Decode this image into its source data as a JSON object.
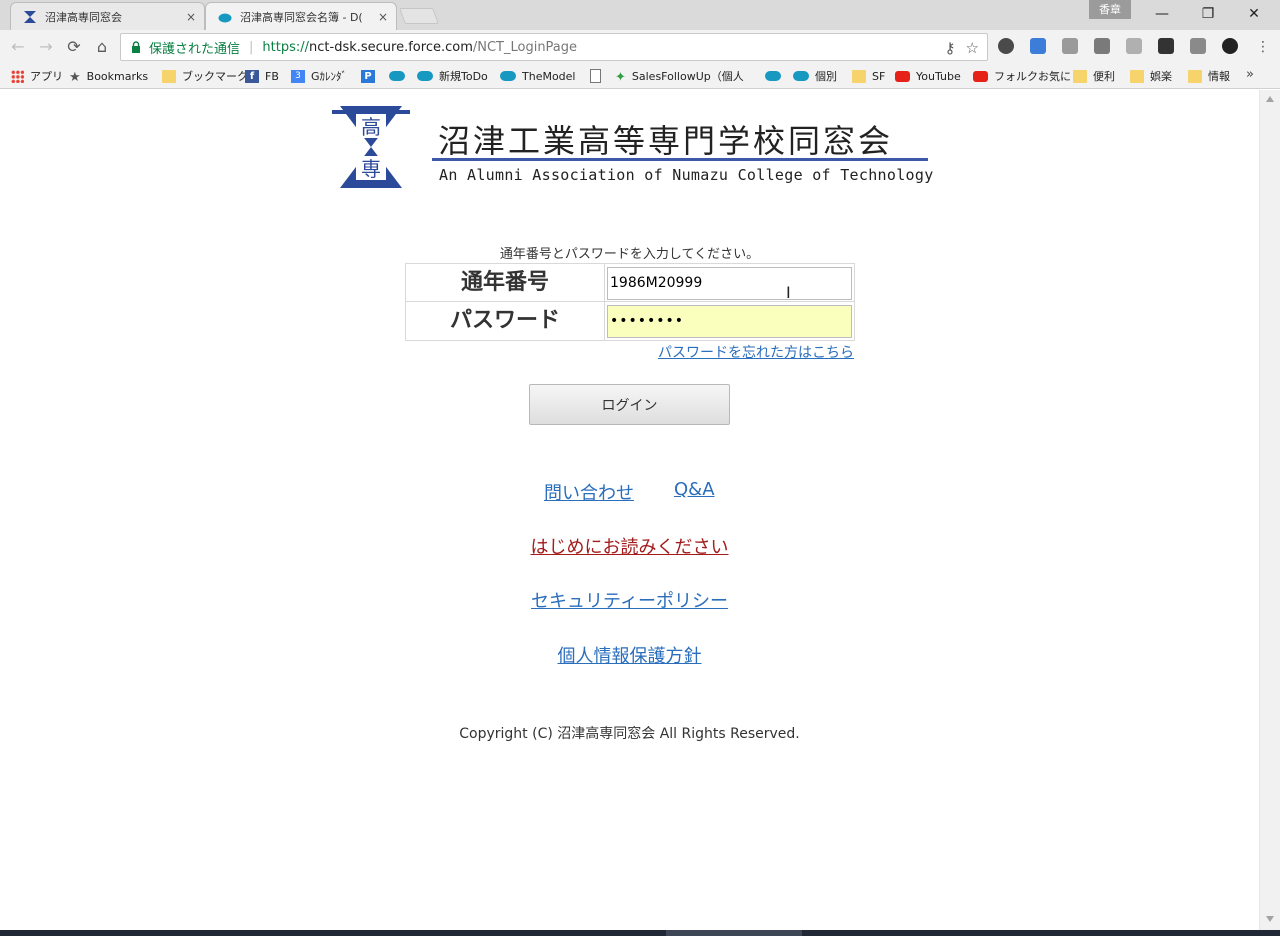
{
  "browser": {
    "tabs": [
      {
        "title": "沼津高専同窓会",
        "close": "×"
      },
      {
        "title": "沼津高専同窓会名簿 - D(",
        "close": "×"
      }
    ],
    "profile_label": "香章",
    "window_controls": {
      "minimize": "—",
      "restore": "❐",
      "close": "✕"
    },
    "nav": {
      "back": "←",
      "forward": "→",
      "reload": "⟳",
      "home": "⌂"
    },
    "omnibox": {
      "secure_text": "保護された通信",
      "separator": "|",
      "scheme": "https://",
      "host": "nct-dsk.secure.force.com",
      "path": "/NCT_LoginPage"
    },
    "omnibox_icons": {
      "key": "⚷",
      "star": "☆"
    },
    "bookmarks": [
      {
        "label": "アプリ",
        "icon": "apps-icon"
      },
      {
        "label": "Bookmarks",
        "icon": "star-icon"
      },
      {
        "label": "ブックマーク",
        "icon": "folder-icon"
      },
      {
        "label": "FB",
        "icon": "facebook-icon"
      },
      {
        "label": "Gｶﾚﾝﾀﾞ",
        "icon": "calendar-icon"
      },
      {
        "label": "",
        "icon": "p-icon"
      },
      {
        "label": "",
        "icon": "salesforce-cloud-icon"
      },
      {
        "label": "新規ToDo",
        "icon": "salesforce-cloud-icon"
      },
      {
        "label": "TheModel",
        "icon": "salesforce-cloud-icon"
      },
      {
        "label": "",
        "icon": "document-icon"
      },
      {
        "label": "SalesFollowUp（個人",
        "icon": "runner-icon"
      },
      {
        "label": "",
        "icon": "salesforce-cloud-icon"
      },
      {
        "label": "個別",
        "icon": "salesforce-cloud-icon"
      },
      {
        "label": "SF",
        "icon": "folder-icon"
      },
      {
        "label": "YouTube",
        "icon": "youtube-icon"
      },
      {
        "label": "フォルクお気に",
        "icon": "youtube-icon"
      },
      {
        "label": "便利",
        "icon": "folder-icon"
      },
      {
        "label": "娯楽",
        "icon": "folder-icon"
      },
      {
        "label": "情報",
        "icon": "folder-icon"
      }
    ],
    "bookmarks_more": "»"
  },
  "page": {
    "logo": {
      "name": "沼津工業高等専門学校同窓会",
      "subtitle": "An Alumni Association of Numazu College of Technology",
      "emblem_text_top": "高",
      "emblem_text_bottom": "専"
    },
    "instruction": "通年番号とパスワードを入力してください。",
    "form": {
      "id_label": "通年番号",
      "id_value": "1986M20999",
      "password_label": "パスワード",
      "password_value": "••••••••"
    },
    "forgot_link": "パスワードを忘れた方はこちら",
    "login_button": "ログイン",
    "links": {
      "inquiry": "問い合わせ",
      "qa": "Q&A",
      "read_first": "はじめにお読みください",
      "security_policy": "セキュリティーポリシー",
      "privacy_policy": "個人情報保護方針"
    },
    "copyright": "Copyright (C) 沼津高専同窓会 All Rights Reserved."
  }
}
